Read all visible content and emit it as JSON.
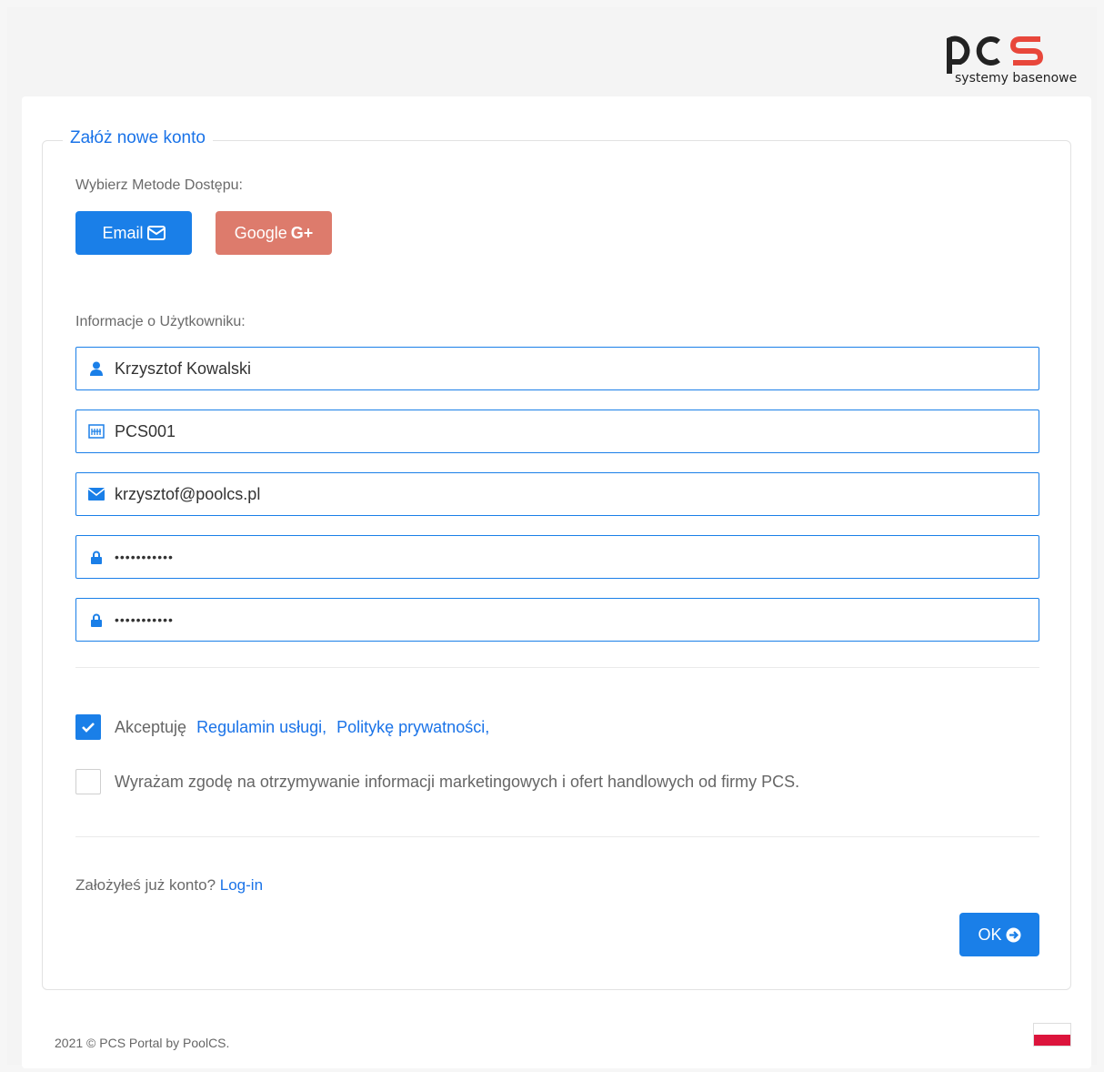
{
  "brand": {
    "logo_text": "pcs",
    "logo_subtitle": "systemy basenowe",
    "accent_color": "#1a7fe8",
    "logo_accent_color": "#e8473b"
  },
  "form": {
    "legend": "Załóż nowe konto",
    "access_method_label": "Wybierz Metode Dostępu:",
    "email_button": "Email",
    "google_button": "Google",
    "google_plus": "G+",
    "user_info_label": "Informacje o Użytkowniku:",
    "fields": {
      "name": "Krzysztof Kowalski",
      "code": "PCS001",
      "email": "krzysztof@poolcs.pl",
      "password": "•••••••••••",
      "password_confirm": "•••••••••••"
    },
    "accept": {
      "prefix": "Akceptuję",
      "terms_link": "Regulamin usługi,",
      "privacy_link": "Politykę prywatności,"
    },
    "marketing_consent": "Wyrażam zgodę na otrzymywanie informacji marketingowych i ofert handlowych od firmy PCS.",
    "login_prompt": "Założyłeś już konto?",
    "login_link": "Log-in",
    "ok_button": "OK"
  },
  "footer": {
    "copyright": "2021 © PCS Portal by PoolCS."
  }
}
